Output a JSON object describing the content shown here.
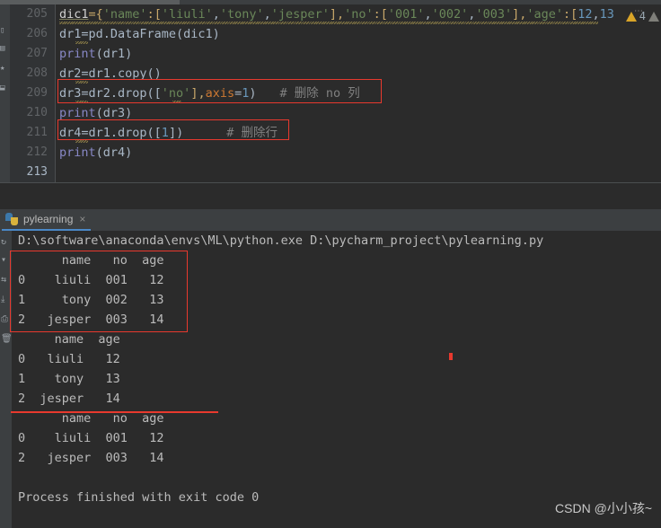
{
  "editor": {
    "first_line_number": 205,
    "lines": [
      {
        "no": "205",
        "current": false
      },
      {
        "no": "206",
        "current": false
      },
      {
        "no": "207",
        "current": false
      },
      {
        "no": "208",
        "current": false
      },
      {
        "no": "209",
        "current": false
      },
      {
        "no": "210",
        "current": false
      },
      {
        "no": "211",
        "current": false
      },
      {
        "no": "212",
        "current": false
      },
      {
        "no": "213",
        "current": true
      }
    ],
    "code": {
      "l205_a": "dic1",
      "l205_b": "={",
      "l205_c": "'name'",
      "l205_d": ":[",
      "l205_e": "'liuli'",
      "l205_f": ",",
      "l205_g": "'tony'",
      "l205_h": ",",
      "l205_i": "'jesper'",
      "l205_j": "],",
      "l205_k": "'no'",
      "l205_l": ":[",
      "l205_m": "'001'",
      "l205_n": ",",
      "l205_o": "'002'",
      "l205_p": ",",
      "l205_q": "'003'",
      "l205_r": "],",
      "l205_s": "'age'",
      "l205_t": ":[",
      "l205_u": "12",
      "l205_v": ",",
      "l205_w": "13",
      "l206": "dr1=pd.DataFrame(dic1)",
      "l207_fn": "print",
      "l207_rest": "(dr1)",
      "l208": "dr2=dr1.copy()",
      "l209_a": "dr3=dr2.drop([",
      "l209_str": "'no'",
      "l209_b": "],",
      "l209_kw": "axis",
      "l209_eq": "=",
      "l209_num": "1",
      "l209_c": ")",
      "l209_cmt": "# 删除 no 列",
      "l210_fn": "print",
      "l210_rest": "(dr3)",
      "l211_a": "dr4=dr1.drop([",
      "l211_num": "1",
      "l211_b": "])",
      "l211_cmt": "# 删除行",
      "l212_fn": "print",
      "l212_rest": "(dr4)"
    },
    "inspection": {
      "warning_count": "4",
      "warning_icon": "warning-triangle-icon",
      "secondary_icon": "weak-warning-triangle-icon",
      "more_icon": "inspection-more-icon"
    }
  },
  "toolwindow": {
    "tab": {
      "label": "pylearning",
      "icon": "python-file-icon",
      "close": "×"
    },
    "toolbar_icons": [
      "rerun-icon",
      "stop-icon",
      "soft-wrap-icon",
      "scroll-to-end-icon",
      "print-icon",
      "clear-all-icon"
    ],
    "console": {
      "command": "D:\\software\\anaconda\\envs\\ML\\python.exe D:\\pycharm_project\\pylearning.py",
      "lines": [
        "      name   no  age",
        "0    liuli  001   12",
        "1     tony  002   13",
        "2   jesper  003   14",
        "     name  age",
        "0   liuli   12",
        "1    tony   13",
        "2  jesper   14",
        "      name   no  age",
        "0    liuli  001   12",
        "2   jesper  003   14",
        "",
        "Process finished with exit code 0"
      ]
    }
  },
  "annotations": {
    "red_color": "#e8392e",
    "editor_box_1_target": "dr3=dr2.drop(['no'],axis=1)   # 删除 no 列",
    "editor_box_2_target": "dr4=dr1.drop([1])       # 删除行",
    "console_box_target": "dr1 DataFrame output table",
    "console_line_target": "separator under dr3 output",
    "console_dot_target": "cursor-mark"
  },
  "watermark": {
    "text": "CSDN @小小孩~"
  }
}
